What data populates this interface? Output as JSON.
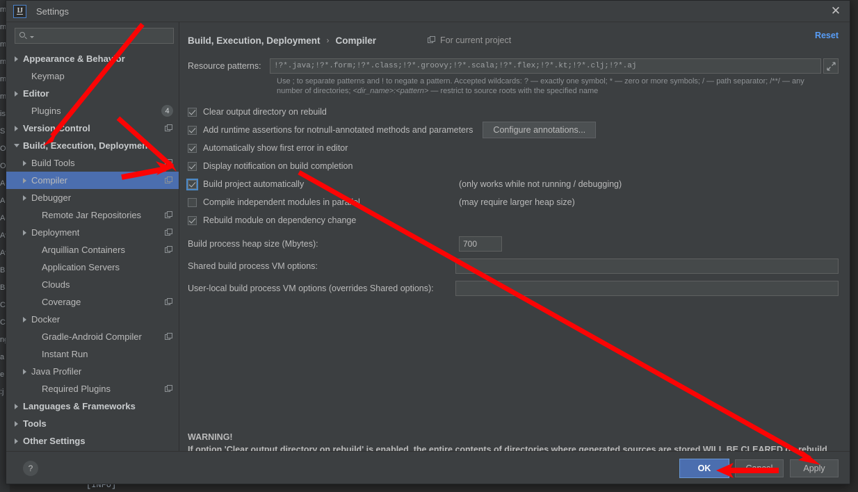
{
  "window": {
    "title": "Settings",
    "logo_text": "IJ",
    "close_icon": "close-icon"
  },
  "sidebar": {
    "search_placeholder": "",
    "search_value": "",
    "items": [
      {
        "label": "Appearance & Behavior",
        "arrow": "right",
        "level": 0,
        "bold": true,
        "badge": "",
        "copy": false,
        "selected": false
      },
      {
        "label": "Keymap",
        "arrow": "none",
        "level": 1,
        "bold": false,
        "badge": "",
        "copy": false,
        "selected": false
      },
      {
        "label": "Editor",
        "arrow": "right",
        "level": 0,
        "bold": true,
        "badge": "",
        "copy": false,
        "selected": false
      },
      {
        "label": "Plugins",
        "arrow": "none",
        "level": 1,
        "bold": false,
        "badge": "4",
        "copy": false,
        "selected": false
      },
      {
        "label": "Version Control",
        "arrow": "right",
        "level": 0,
        "bold": true,
        "badge": "",
        "copy": true,
        "selected": false
      },
      {
        "label": "Build, Execution, Deployment",
        "arrow": "down",
        "level": 0,
        "bold": true,
        "badge": "",
        "copy": false,
        "selected": false
      },
      {
        "label": "Build Tools",
        "arrow": "right",
        "level": 1,
        "bold": false,
        "badge": "",
        "copy": true,
        "selected": false
      },
      {
        "label": "Compiler",
        "arrow": "right",
        "level": 1,
        "bold": false,
        "badge": "",
        "copy": true,
        "selected": true
      },
      {
        "label": "Debugger",
        "arrow": "right",
        "level": 1,
        "bold": false,
        "badge": "",
        "copy": false,
        "selected": false
      },
      {
        "label": "Remote Jar Repositories",
        "arrow": "none",
        "level": 2,
        "bold": false,
        "badge": "",
        "copy": true,
        "selected": false
      },
      {
        "label": "Deployment",
        "arrow": "right",
        "level": 1,
        "bold": false,
        "badge": "",
        "copy": true,
        "selected": false
      },
      {
        "label": "Arquillian Containers",
        "arrow": "none",
        "level": 2,
        "bold": false,
        "badge": "",
        "copy": true,
        "selected": false
      },
      {
        "label": "Application Servers",
        "arrow": "none",
        "level": 2,
        "bold": false,
        "badge": "",
        "copy": false,
        "selected": false
      },
      {
        "label": "Clouds",
        "arrow": "none",
        "level": 2,
        "bold": false,
        "badge": "",
        "copy": false,
        "selected": false
      },
      {
        "label": "Coverage",
        "arrow": "none",
        "level": 2,
        "bold": false,
        "badge": "",
        "copy": true,
        "selected": false
      },
      {
        "label": "Docker",
        "arrow": "right",
        "level": 1,
        "bold": false,
        "badge": "",
        "copy": false,
        "selected": false
      },
      {
        "label": "Gradle-Android Compiler",
        "arrow": "none",
        "level": 2,
        "bold": false,
        "badge": "",
        "copy": true,
        "selected": false
      },
      {
        "label": "Instant Run",
        "arrow": "none",
        "level": 2,
        "bold": false,
        "badge": "",
        "copy": false,
        "selected": false
      },
      {
        "label": "Java Profiler",
        "arrow": "right",
        "level": 1,
        "bold": false,
        "badge": "",
        "copy": false,
        "selected": false
      },
      {
        "label": "Required Plugins",
        "arrow": "none",
        "level": 2,
        "bold": false,
        "badge": "",
        "copy": true,
        "selected": false
      },
      {
        "label": "Languages & Frameworks",
        "arrow": "right",
        "level": 0,
        "bold": true,
        "badge": "",
        "copy": false,
        "selected": false
      },
      {
        "label": "Tools",
        "arrow": "right",
        "level": 0,
        "bold": true,
        "badge": "",
        "copy": false,
        "selected": false
      },
      {
        "label": "Other Settings",
        "arrow": "right",
        "level": 0,
        "bold": true,
        "badge": "",
        "copy": false,
        "selected": false
      }
    ]
  },
  "main": {
    "breadcrumb_parent": "Build, Execution, Deployment",
    "breadcrumb_sep": "›",
    "breadcrumb_current": "Compiler",
    "for_current_project": "For current project",
    "reset_label": "Reset",
    "resource_patterns_label": "Resource patterns:",
    "resource_patterns_value": "!?*.java;!?*.form;!?*.class;!?*.groovy;!?*.scala;!?*.flex;!?*.kt;!?*.clj;!?*.aj",
    "hint_line1": "Use ; to separate patterns and ! to negate a pattern. Accepted wildcards: ? — exactly one symbol; * — zero or more symbols; / — path separator; /**/ — any",
    "hint_line2_prefix": "number of directories;",
    "hint_line2_italic": "<dir_name>:<pattern>",
    "hint_line2_suffix": "— restrict to source roots with the specified name",
    "checkboxes": [
      {
        "label": "Clear output directory on rebuild",
        "checked": true,
        "focused": false,
        "note": "",
        "button": ""
      },
      {
        "label": "Add runtime assertions for notnull-annotated methods and parameters",
        "checked": true,
        "focused": false,
        "note": "",
        "button": "Configure annotations..."
      },
      {
        "label": "Automatically show first error in editor",
        "checked": true,
        "focused": false,
        "note": "",
        "button": ""
      },
      {
        "label": "Display notification on build completion",
        "checked": true,
        "focused": false,
        "note": "",
        "button": ""
      },
      {
        "label": "Build project automatically",
        "checked": true,
        "focused": true,
        "note": "(only works while not running / debugging)",
        "button": ""
      },
      {
        "label": "Compile independent modules in parallel",
        "checked": false,
        "focused": false,
        "note": "(may require larger heap size)",
        "button": ""
      },
      {
        "label": "Rebuild module on dependency change",
        "checked": true,
        "focused": false,
        "note": "",
        "button": ""
      }
    ],
    "heap_label": "Build process heap size (Mbytes):",
    "heap_value": "700",
    "shared_vm_label": "Shared build process VM options:",
    "shared_vm_value": "",
    "userlocal_vm_label": "User-local build process VM options (overrides Shared options):",
    "userlocal_vm_value": "",
    "warning_title": "WARNING!",
    "warning_body": "If option 'Clear output directory on rebuild' is enabled, the entire contents of directories where generated sources are stored WILL BE CLEARED on rebuild."
  },
  "footer": {
    "help_label": "?",
    "ok_label": "OK",
    "cancel_label": "Cancel",
    "apply_label": "Apply"
  },
  "background": {
    "console_text": "[INFO]",
    "gutter_text": "m\nm\nm\nm\nm\nm\nis\nS\nO\nO\n\n\n\nAc\nAc\nAg\nAv\nAv\nBa\nBa\nCa\nCa\n\nng\na\ne\n:j"
  },
  "colors": {
    "accent_blue": "#4b6eaf",
    "link_blue": "#589df6",
    "dialog_bg": "#3c3f41",
    "field_bg": "#45494a",
    "annotation_red": "#fb0404"
  }
}
